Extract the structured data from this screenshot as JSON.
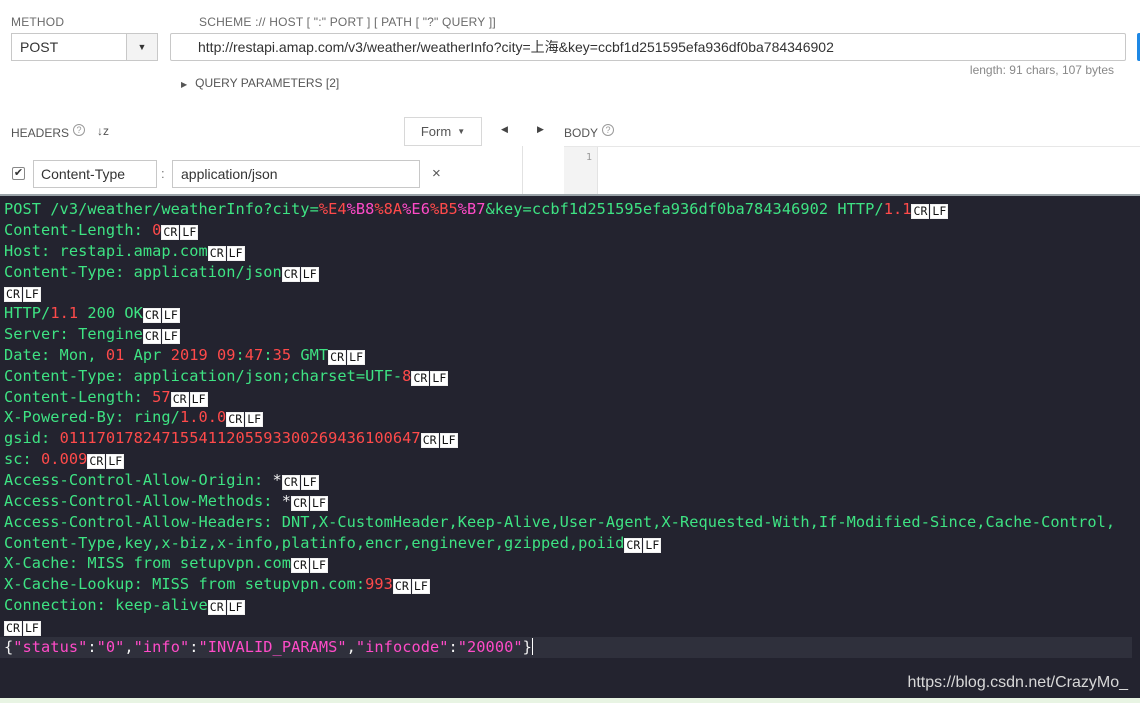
{
  "request": {
    "method_label": "METHOD",
    "method_value": "POST",
    "url_label": "SCHEME :// HOST [ \":\" PORT ] [ PATH [ \"?\" QUERY ]]",
    "url_value": "http://restapi.amap.com/v3/weather/weatherInfo?city=上海&key=ccbf1d251595efa936df0ba784346902",
    "length_info": "length: 91 chars, 107 bytes",
    "query_params_label": "QUERY PARAMETERS [2]"
  },
  "headers_panel": {
    "label": "HEADERS",
    "help_glyph": "?",
    "sort_glyph": "↓z",
    "form_button": "Form",
    "header_key": "Content-Type",
    "header_separator": ":",
    "header_value": "application/json",
    "delete_glyph": "×"
  },
  "body_panel": {
    "label": "BODY",
    "help_glyph": "?",
    "line_number": "1"
  },
  "terminal": {
    "lines": [
      [
        {
          "t": "POST /v3/weather/weatherInfo?city="
        },
        {
          "t": "%E4",
          "c": "r"
        },
        {
          "t": "%B8",
          "c": "p"
        },
        {
          "t": "%8A",
          "c": "r"
        },
        {
          "t": "%E6",
          "c": "p"
        },
        {
          "t": "%B5",
          "c": "r"
        },
        {
          "t": "%B7",
          "c": "p"
        },
        {
          "t": "&key=ccbf1d251595efa936df0ba784346902 HTTP/"
        },
        {
          "t": "1.1",
          "c": "r"
        },
        {
          "crlf": true
        }
      ],
      [
        {
          "t": "Content-Length: "
        },
        {
          "t": "0",
          "c": "r"
        },
        {
          "crlf": true
        }
      ],
      [
        {
          "t": "Host: restapi.amap.com"
        },
        {
          "crlf": true
        }
      ],
      [
        {
          "t": "Content-Type: application/json"
        },
        {
          "crlf": true
        }
      ],
      [
        {
          "crlf": true
        }
      ],
      [
        {
          "t": "HTTP/"
        },
        {
          "t": "1.1",
          "c": "r"
        },
        {
          "t": " 200 OK"
        },
        {
          "crlf": true
        }
      ],
      [
        {
          "t": "Server: Tengine"
        },
        {
          "crlf": true
        }
      ],
      [
        {
          "t": "Date: Mon, "
        },
        {
          "t": "01",
          "c": "r"
        },
        {
          "t": " Apr "
        },
        {
          "t": "2019 09",
          "c": "r"
        },
        {
          "t": ":"
        },
        {
          "t": "47",
          "c": "r"
        },
        {
          "t": ":"
        },
        {
          "t": "35",
          "c": "r"
        },
        {
          "t": " GMT"
        },
        {
          "crlf": true
        }
      ],
      [
        {
          "t": "Content-Type: application/json;charset=UTF-"
        },
        {
          "t": "8",
          "c": "r"
        },
        {
          "crlf": true
        }
      ],
      [
        {
          "t": "Content-Length: "
        },
        {
          "t": "57",
          "c": "r"
        },
        {
          "crlf": true
        }
      ],
      [
        {
          "t": "X-Powered-By: ring/"
        },
        {
          "t": "1.0.0",
          "c": "r"
        },
        {
          "crlf": true
        }
      ],
      [
        {
          "t": "gsid: "
        },
        {
          "t": "011170178247155411205593300269436100647",
          "c": "r"
        },
        {
          "crlf": true
        }
      ],
      [
        {
          "t": "sc: "
        },
        {
          "t": "0.009",
          "c": "r"
        },
        {
          "crlf": true
        }
      ],
      [
        {
          "t": "Access-Control-Allow-Origin: "
        },
        {
          "t": "*",
          "c": "w"
        },
        {
          "crlf": true
        }
      ],
      [
        {
          "t": "Access-Control-Allow-Methods: "
        },
        {
          "t": "*",
          "c": "w"
        },
        {
          "crlf": true
        }
      ],
      [
        {
          "t": "Access-Control-Allow-Headers: DNT,X-CustomHeader,Keep-Alive,User-Agent,X-Requested-With,If-Modified-Since,Cache-Control,"
        }
      ],
      [
        {
          "t": "Content-Type,key,x-biz,x-info,platinfo,encr,enginever,gzipped,poiid"
        },
        {
          "crlf": true
        }
      ],
      [
        {
          "t": "X-Cache: MISS from setupvpn.com"
        },
        {
          "crlf": true
        }
      ],
      [
        {
          "t": "X-Cache-Lookup: MISS from setupvpn.com:"
        },
        {
          "t": "993",
          "c": "r"
        },
        {
          "crlf": true
        }
      ],
      [
        {
          "t": "Connection: keep-alive"
        },
        {
          "crlf": true
        }
      ],
      [
        {
          "crlf": true
        }
      ],
      [
        {
          "t": "{",
          "c": "w"
        },
        {
          "t": "\"status\"",
          "c": "p"
        },
        {
          "t": ":",
          "c": "w"
        },
        {
          "t": "\"0\"",
          "c": "p"
        },
        {
          "t": ",",
          "c": "w"
        },
        {
          "t": "\"info\"",
          "c": "p"
        },
        {
          "t": ":",
          "c": "w"
        },
        {
          "t": "\"INVALID_PARAMS\"",
          "c": "p"
        },
        {
          "t": ",",
          "c": "w"
        },
        {
          "t": "\"infocode\"",
          "c": "p"
        },
        {
          "t": ":",
          "c": "w"
        },
        {
          "t": "\"20000\"",
          "c": "p"
        },
        {
          "t": "}",
          "c": "w"
        },
        {
          "caret": true
        }
      ]
    ],
    "cr_label": "CR",
    "lf_label": "LF",
    "highlighted_line": 21
  },
  "watermark": "https://blog.csdn.net/CrazyMo_",
  "colors": {
    "terminal_bg": "#23232f",
    "terminal_text": "#3ee383",
    "number_red": "#ff4a4a",
    "string_pink": "#ff4bc8",
    "accent_blue": "#1e88e5"
  }
}
